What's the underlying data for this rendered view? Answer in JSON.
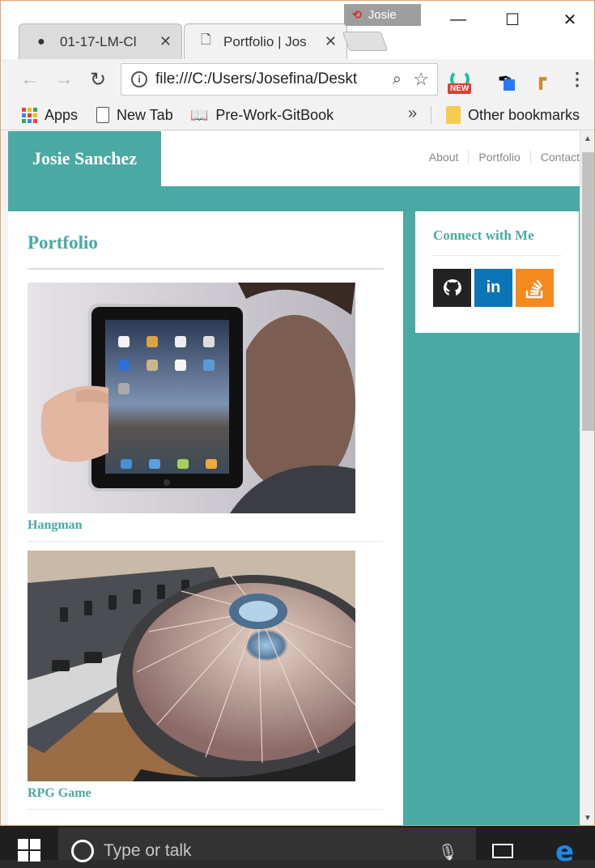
{
  "window": {
    "profile_name": "Josie",
    "minimize": "—",
    "maximize": "☐",
    "close": "✕"
  },
  "tabs": [
    {
      "title": "01-17-LM-Cl",
      "icon": "github-icon",
      "active": false
    },
    {
      "title": "Portfolio | Jos",
      "icon": "page-icon",
      "active": true
    }
  ],
  "toolbar": {
    "url": "file:///C:/Users/Josefina/Deskt",
    "back": "←",
    "forward": "→",
    "reload": "↻",
    "grammarly_badge": "NEW",
    "menu": "⋮"
  },
  "bookmarks": {
    "items": [
      "Apps",
      "New Tab",
      "Pre-Work-GitBook"
    ],
    "overflow": "»",
    "other": "Other bookmarks"
  },
  "site": {
    "brand": "Josie Sanchez",
    "nav": [
      "About",
      "Portfolio",
      "Contact"
    ],
    "heading": "Portfolio",
    "projects": [
      {
        "caption": "Hangman"
      },
      {
        "caption": "RPG Game"
      }
    ],
    "sidebar_title": "Connect with Me",
    "social": [
      "github-icon",
      "linkedin-icon",
      "stackoverflow-icon"
    ],
    "accent": "#4aa9a3"
  },
  "taskbar": {
    "search_placeholder": "Type or talk"
  }
}
